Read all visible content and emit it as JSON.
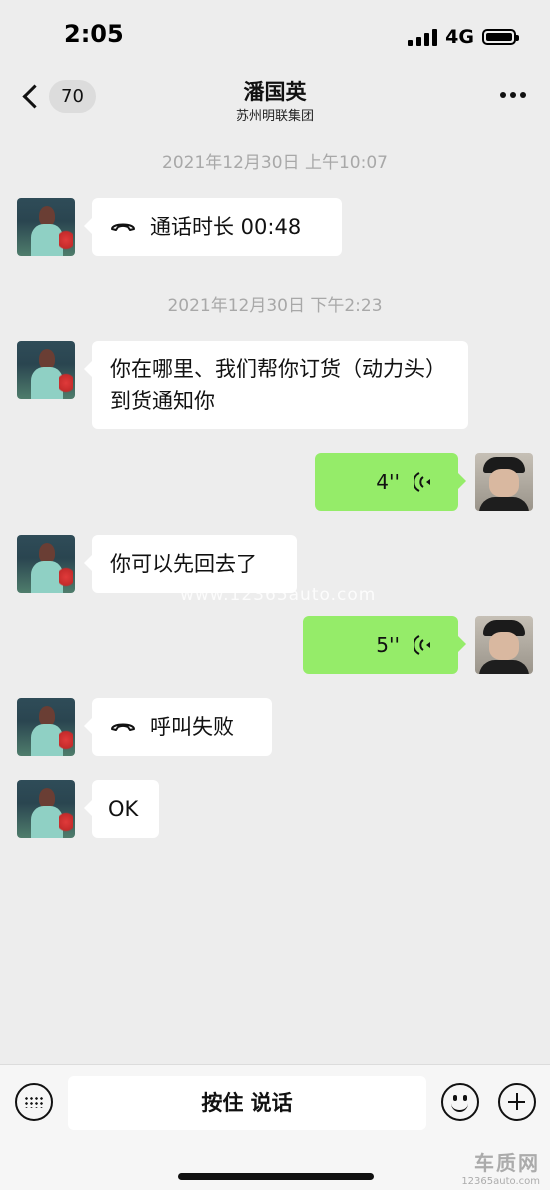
{
  "status_bar": {
    "time": "2:05",
    "network": "4G"
  },
  "nav": {
    "unread_count": "70",
    "title": "潘国英",
    "subtitle": "苏州明联集团"
  },
  "messages": {
    "ts1": "2021年12月30日 上午10:07",
    "call1": "通话时长 00:48",
    "ts2": "2021年12月30日 下午2:23",
    "text1": "你在哪里、我们帮你订货（动力头）到货通知你",
    "voice1": "4''",
    "text2": "你可以先回去了",
    "voice2": "5''",
    "call2": "呼叫失败",
    "text3": "OK"
  },
  "watermark": "www.12365auto.com",
  "bottom_bar": {
    "talk_label": "按住 说话"
  },
  "logo": {
    "cn": "车质网",
    "en": "12365auto.com"
  },
  "colors": {
    "background": "#ededed",
    "bubble_in": "#ffffff",
    "bubble_out": "#95ec69",
    "timestamp": "#a8a8a8"
  }
}
